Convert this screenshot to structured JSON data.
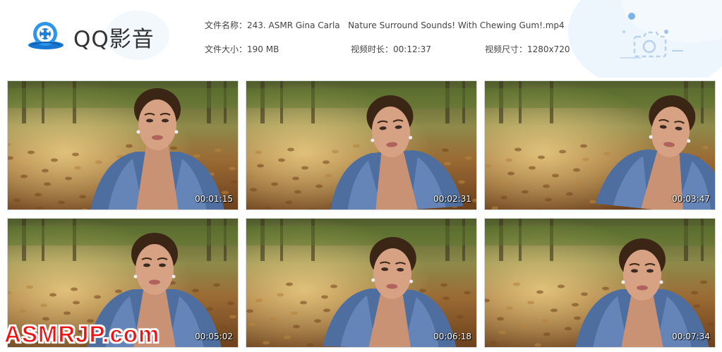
{
  "app": {
    "name": "QQ影音"
  },
  "file": {
    "name_label": "文件名称：",
    "name": "243. ASMR Gina Carla   Nature Surround Sounds! With Chewing Gum!.mp4",
    "size_label": "文件大小：",
    "size": "190 MB",
    "duration_label": "视频时长：",
    "duration": "00:12:37",
    "resolution_label": "视频尺寸：",
    "resolution": "1280x720"
  },
  "thumbnails": [
    {
      "time": "00:01:15"
    },
    {
      "time": "00:02:31"
    },
    {
      "time": "00:03:47"
    },
    {
      "time": "00:05:02"
    },
    {
      "time": "00:06:18"
    },
    {
      "time": "00:07:34"
    }
  ],
  "watermark": {
    "text": "ASMRJP.com"
  },
  "colors": {
    "brand_blue": "#1e88e5",
    "deco_blue": "#e9f3fc",
    "watermark_red": "#f31010"
  },
  "icons": {
    "logo": "qq-player-logo-icon",
    "camera": "camera-screenshot-icon"
  }
}
